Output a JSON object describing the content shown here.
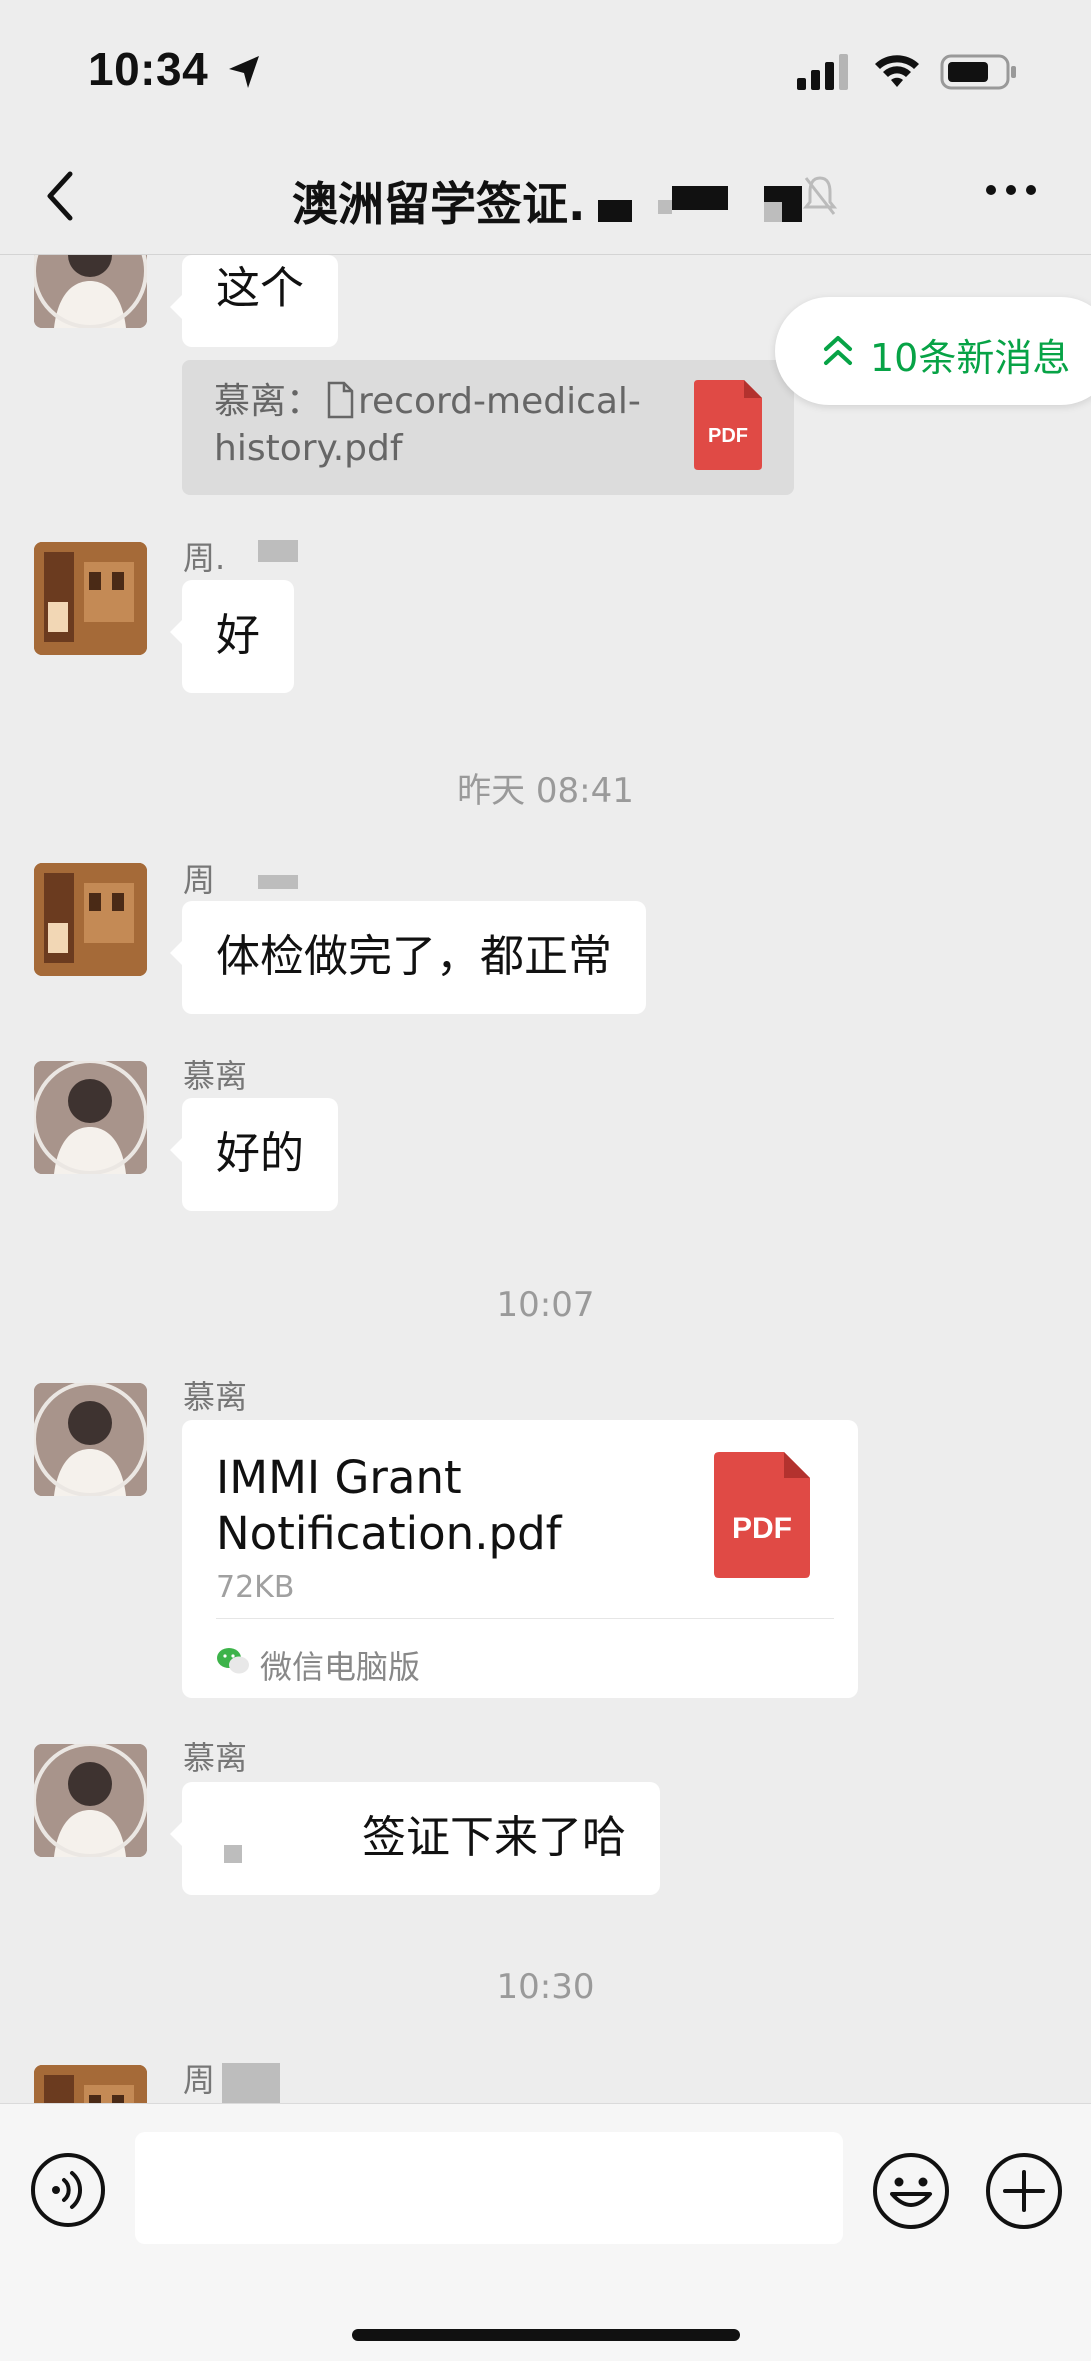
{
  "status_bar": {
    "time": "10:34"
  },
  "header": {
    "title": "澳洲留学签证."
  },
  "new_messages": {
    "label": "10条新消息"
  },
  "messages": {
    "m1": {
      "text": "这个"
    },
    "quote": {
      "text": "慕离：",
      "file": "record-medical-history.pdf",
      "file_line1": "record-medical-",
      "file_line2": "history.pdf",
      "badge": "PDF"
    },
    "m2": {
      "sender": "周.",
      "text": "好"
    },
    "time1": "昨天 08:41",
    "m3": {
      "sender": "周",
      "text": "体检做完了，都正常"
    },
    "m4": {
      "sender": "慕离",
      "text": "好的"
    },
    "time2": "10:07",
    "m5": {
      "sender": "慕离",
      "file_name": "IMMI Grant Notification.pdf",
      "file_line1": "IMMI Grant",
      "file_line2": "Notification.pdf",
      "size": "72KB",
      "source": "微信电脑版",
      "badge": "PDF"
    },
    "m6": {
      "sender": "慕离",
      "text": "签证下来了哈"
    },
    "time3": "10:30",
    "m7": {
      "sender": "周"
    }
  },
  "colors": {
    "background": "#ededed",
    "accent_green": "#07a346",
    "pdf_red": "#e04a45"
  }
}
